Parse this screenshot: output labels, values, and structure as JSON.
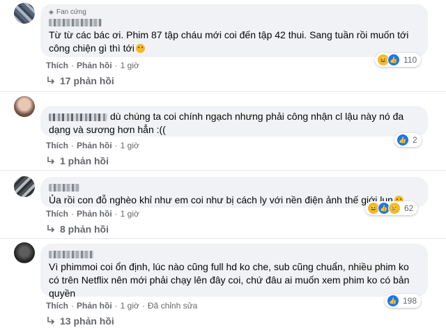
{
  "comments": [
    {
      "badge": "Fan cứng",
      "text": "Từ từ các bác ơi. Phim 87 tập cháu mới coi đến tập 42 thui. Sang tuần rồi muốn tới công chiện gì thì tới",
      "reactions": {
        "icons": [
          "haha-icon",
          "like-icon"
        ],
        "count": "110"
      },
      "actions": {
        "like": "Thích",
        "reply": "Phản hồi",
        "time": "1 giờ"
      },
      "replies": "17 phản hồi"
    },
    {
      "name_prefix": "Thương .",
      "text": "dù chúng ta coi chính ngạch nhưng phải công nhận cl lậu này nó đa dạng và sương hơn hẳn :((",
      "reactions": {
        "icons": [
          "like-icon"
        ],
        "count": "2"
      },
      "actions": {
        "like": "Thích",
        "reply": "Phản hồi",
        "time": "1 giờ"
      },
      "replies": "1 phản hồi"
    },
    {
      "text": "Ủa rồi con đỗ nghèo khỉ như em coi như bị cách ly với nền điện ảnh thế giới lun",
      "reactions": {
        "icons": [
          "haha-icon",
          "like-icon",
          "sad-icon"
        ],
        "count": "62"
      },
      "actions": {
        "like": "Thích",
        "reply": "Phản hồi",
        "time": "1 giờ"
      },
      "replies": "8 phản hồi"
    },
    {
      "text": "Vì phimmoi coi ổn định, lúc nào cũng full hd ko che, sub cũng chuẩn, nhiều phim ko có trên Netflix nên mới phải chạy lên đây coi, chứ đâu ai muốn xem phim ko có bản quyền",
      "reactions": {
        "icons": [
          "like-icon"
        ],
        "count": "198"
      },
      "actions": {
        "like": "Thích",
        "reply": "Phản hồi",
        "time": "1 giờ",
        "edited": "Đã chỉnh sửa"
      },
      "replies": "13 phản hồi"
    }
  ]
}
